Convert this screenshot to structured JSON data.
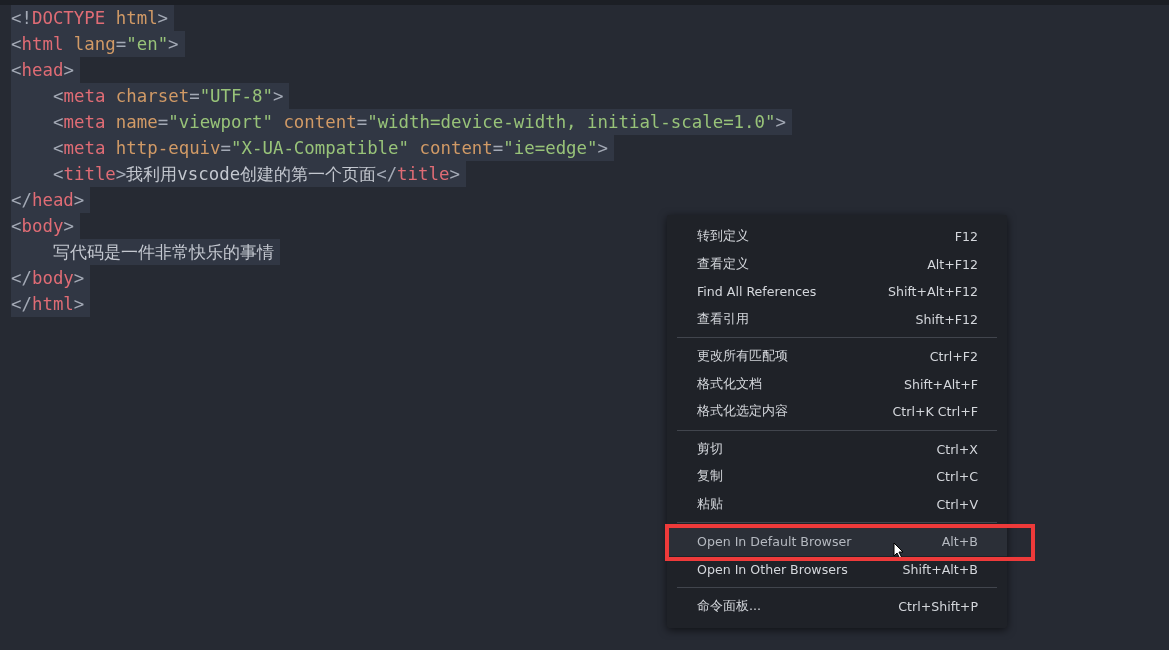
{
  "editor": {
    "lines": [
      {
        "indented": false,
        "tokens": [
          {
            "kind": "punct",
            "text": "<!"
          },
          {
            "kind": "tag",
            "text": "DOCTYPE"
          },
          {
            "kind": "attr",
            "text": " html"
          },
          {
            "kind": "punct",
            "text": ">"
          }
        ]
      },
      {
        "indented": false,
        "tokens": [
          {
            "kind": "punct",
            "text": "<"
          },
          {
            "kind": "tag",
            "text": "html"
          },
          {
            "kind": "attr",
            "text": " lang"
          },
          {
            "kind": "punct",
            "text": "="
          },
          {
            "kind": "string",
            "text": "\"en\""
          },
          {
            "kind": "punct",
            "text": ">"
          }
        ]
      },
      {
        "indented": false,
        "tokens": [
          {
            "kind": "punct",
            "text": "<"
          },
          {
            "kind": "tag",
            "text": "head"
          },
          {
            "kind": "punct",
            "text": ">"
          }
        ]
      },
      {
        "indented": true,
        "tokens": [
          {
            "kind": "punct",
            "text": "<"
          },
          {
            "kind": "tag",
            "text": "meta"
          },
          {
            "kind": "attr",
            "text": " charset"
          },
          {
            "kind": "punct",
            "text": "="
          },
          {
            "kind": "string",
            "text": "\"UTF-8\""
          },
          {
            "kind": "punct",
            "text": ">"
          }
        ]
      },
      {
        "indented": true,
        "tokens": [
          {
            "kind": "punct",
            "text": "<"
          },
          {
            "kind": "tag",
            "text": "meta"
          },
          {
            "kind": "attr",
            "text": " name"
          },
          {
            "kind": "punct",
            "text": "="
          },
          {
            "kind": "string",
            "text": "\"viewport\""
          },
          {
            "kind": "attr",
            "text": " content"
          },
          {
            "kind": "punct",
            "text": "="
          },
          {
            "kind": "string",
            "text": "\"width=device-width, initial-scale=1.0\""
          },
          {
            "kind": "punct",
            "text": ">"
          }
        ]
      },
      {
        "indented": true,
        "tokens": [
          {
            "kind": "punct",
            "text": "<"
          },
          {
            "kind": "tag",
            "text": "meta"
          },
          {
            "kind": "attr",
            "text": " http-equiv"
          },
          {
            "kind": "punct",
            "text": "="
          },
          {
            "kind": "string",
            "text": "\"X-UA-Compatible\""
          },
          {
            "kind": "attr",
            "text": " content"
          },
          {
            "kind": "punct",
            "text": "="
          },
          {
            "kind": "string",
            "text": "\"ie=edge\""
          },
          {
            "kind": "punct",
            "text": ">"
          }
        ]
      },
      {
        "indented": true,
        "tokens": [
          {
            "kind": "punct",
            "text": "<"
          },
          {
            "kind": "tag",
            "text": "title"
          },
          {
            "kind": "punct",
            "text": ">"
          },
          {
            "kind": "text",
            "text": "我利用vscode创建的第一个页面"
          },
          {
            "kind": "punct",
            "text": "</"
          },
          {
            "kind": "tag",
            "text": "title"
          },
          {
            "kind": "punct",
            "text": ">"
          }
        ]
      },
      {
        "indented": false,
        "tokens": [
          {
            "kind": "punct",
            "text": "</"
          },
          {
            "kind": "tag",
            "text": "head"
          },
          {
            "kind": "punct",
            "text": ">"
          }
        ]
      },
      {
        "indented": false,
        "tokens": [
          {
            "kind": "punct",
            "text": "<"
          },
          {
            "kind": "tag",
            "text": "body"
          },
          {
            "kind": "punct",
            "text": ">"
          }
        ]
      },
      {
        "indented": true,
        "tokens": [
          {
            "kind": "text",
            "text": "写代码是一件非常快乐的事情"
          }
        ]
      },
      {
        "indented": false,
        "tokens": [
          {
            "kind": "punct",
            "text": "</"
          },
          {
            "kind": "tag",
            "text": "body"
          },
          {
            "kind": "punct",
            "text": ">"
          }
        ]
      },
      {
        "indented": false,
        "tokens": [
          {
            "kind": "punct",
            "text": "</"
          },
          {
            "kind": "tag",
            "text": "html"
          },
          {
            "kind": "punct",
            "text": ">"
          }
        ]
      }
    ]
  },
  "context_menu": {
    "groups": [
      {
        "items": [
          {
            "label": "转到定义",
            "shortcut": "F12",
            "selected": false,
            "annotated": false
          },
          {
            "label": "查看定义",
            "shortcut": "Alt+F12",
            "selected": false,
            "annotated": false
          },
          {
            "label": "Find All References",
            "shortcut": "Shift+Alt+F12",
            "selected": false,
            "annotated": false
          },
          {
            "label": "查看引用",
            "shortcut": "Shift+F12",
            "selected": false,
            "annotated": false
          }
        ]
      },
      {
        "items": [
          {
            "label": "更改所有匹配项",
            "shortcut": "Ctrl+F2",
            "selected": false,
            "annotated": false
          },
          {
            "label": "格式化文档",
            "shortcut": "Shift+Alt+F",
            "selected": false,
            "annotated": false
          },
          {
            "label": "格式化选定内容",
            "shortcut": "Ctrl+K Ctrl+F",
            "selected": false,
            "annotated": false
          }
        ]
      },
      {
        "items": [
          {
            "label": "剪切",
            "shortcut": "Ctrl+X",
            "selected": false,
            "annotated": false
          },
          {
            "label": "复制",
            "shortcut": "Ctrl+C",
            "selected": false,
            "annotated": false
          },
          {
            "label": "粘贴",
            "shortcut": "Ctrl+V",
            "selected": false,
            "annotated": false
          }
        ]
      },
      {
        "items": [
          {
            "label": "Open In Default Browser",
            "shortcut": "Alt+B",
            "selected": true,
            "annotated": true
          },
          {
            "label": "Open In Other Browsers",
            "shortcut": "Shift+Alt+B",
            "selected": false,
            "annotated": false
          }
        ]
      },
      {
        "items": [
          {
            "label": "命令面板...",
            "shortcut": "Ctrl+Shift+P",
            "selected": false,
            "annotated": false
          }
        ]
      }
    ]
  }
}
